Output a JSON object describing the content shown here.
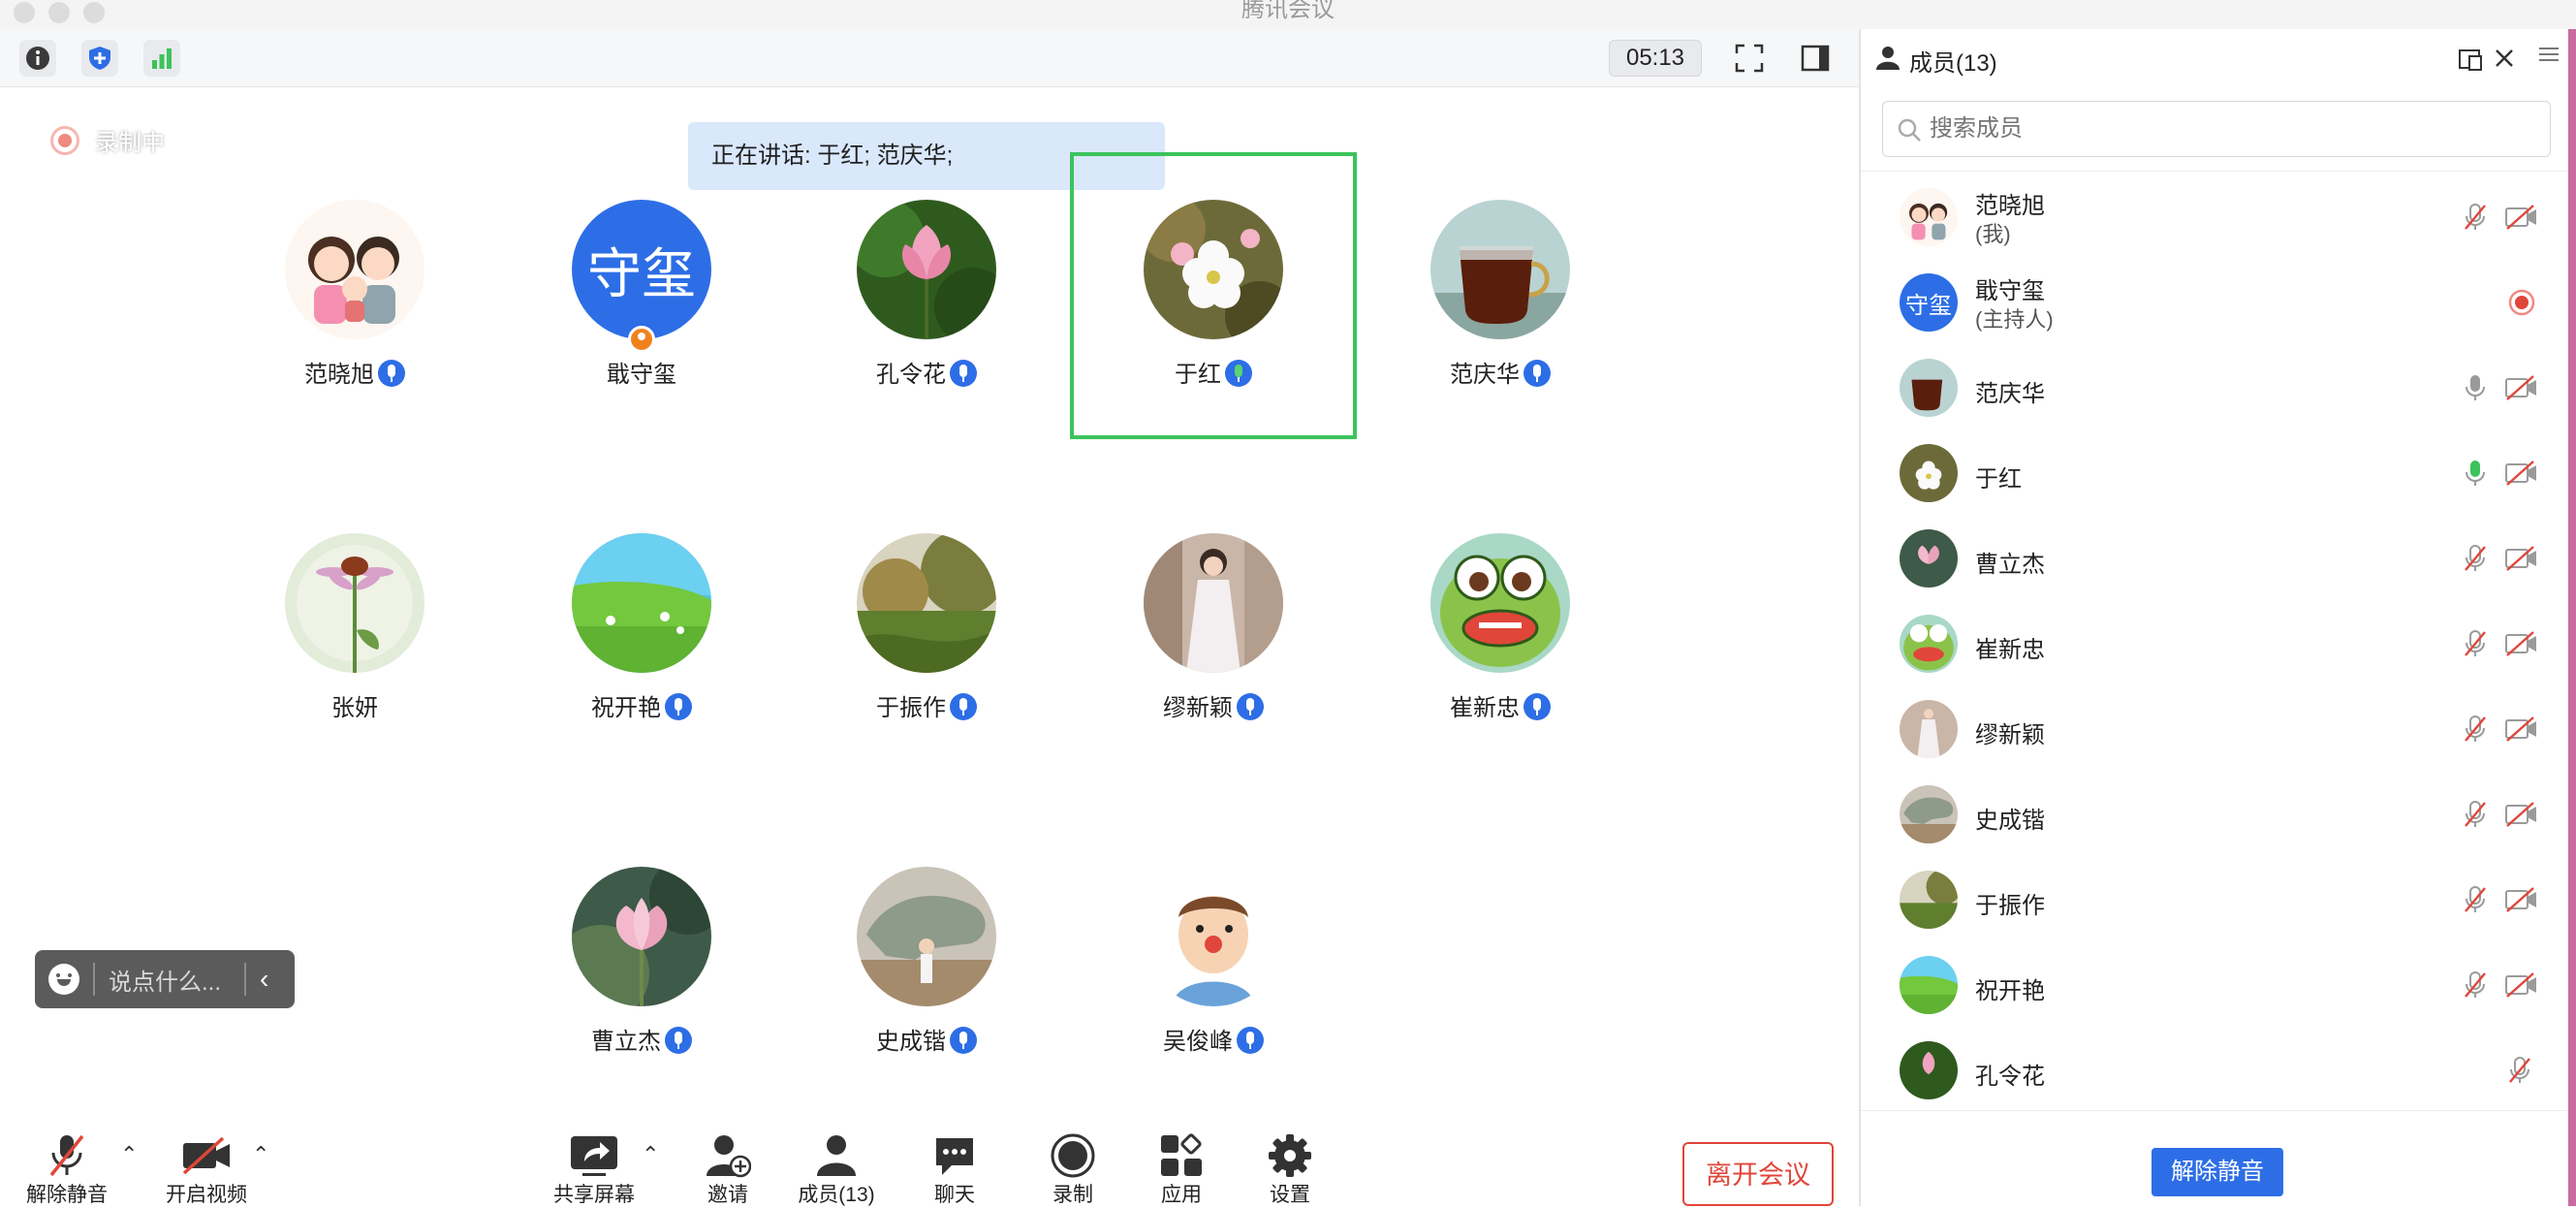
{
  "app": {
    "title": "腾讯会议"
  },
  "topbar": {
    "timer": "05:13"
  },
  "recording": {
    "label": "录制中"
  },
  "speaking": {
    "text": "正在讲话: 于红; 范庆华;"
  },
  "participants": [
    {
      "name": "范晓旭",
      "avatar": "cartoon-family-avatar",
      "mic_badge": true
    },
    {
      "name": "戢守玺",
      "avatar": "text-avatar",
      "avatar_text": "守玺",
      "host_badge": true,
      "mic_badge": false
    },
    {
      "name": "孔令花",
      "avatar": "pink-lotus-avatar",
      "mic_badge": true
    },
    {
      "name": "于红",
      "avatar": "white-flower-avatar",
      "mic_badge": true,
      "speaking": true
    },
    {
      "name": "范庆华",
      "avatar": "tea-cup-avatar",
      "mic_badge": true
    },
    {
      "name": "张妍",
      "avatar": "coneflower-avatar",
      "mic_badge": false
    },
    {
      "name": "祝开艳",
      "avatar": "green-meadow-avatar",
      "mic_badge": true
    },
    {
      "name": "于振作",
      "avatar": "autumn-grass-avatar",
      "mic_badge": true
    },
    {
      "name": "缪新颖",
      "avatar": "girl-white-dress-avatar",
      "mic_badge": true
    },
    {
      "name": "崔新忠",
      "avatar": "cartoon-frog-avatar",
      "mic_badge": true
    },
    {
      "name": "曹立杰",
      "avatar": "lotus-bud-avatar",
      "mic_badge": true
    },
    {
      "name": "史成锴",
      "avatar": "dinosaur-statue-avatar",
      "mic_badge": true
    },
    {
      "name": "吴俊峰",
      "avatar": "cartoon-boy-avatar",
      "mic_badge": true
    }
  ],
  "chat_input": {
    "placeholder": "说点什么..."
  },
  "toolbar": {
    "unmute": "解除静音",
    "start_video": "开启视频",
    "share_screen": "共享屏幕",
    "invite": "邀请",
    "members": "成员(13)",
    "chat": "聊天",
    "record": "录制",
    "apps": "应用",
    "settings": "设置",
    "leave": "离开会议"
  },
  "panel": {
    "title": "成员(13)",
    "search_placeholder": "搜索成员",
    "unmute_all": "解除静音",
    "members": [
      {
        "name": "范晓旭",
        "sub": "(我)",
        "mic": "muted",
        "cam": "off"
      },
      {
        "name": "戢守玺",
        "sub": "(主持人)",
        "status": "recording",
        "avatar_text": "守玺"
      },
      {
        "name": "范庆华",
        "mic": "on",
        "cam": "off"
      },
      {
        "name": "于红",
        "mic": "speaking",
        "cam": "off"
      },
      {
        "name": "曹立杰",
        "mic": "muted",
        "cam": "off"
      },
      {
        "name": "崔新忠",
        "mic": "muted",
        "cam": "off"
      },
      {
        "name": "缪新颖",
        "mic": "muted",
        "cam": "off"
      },
      {
        "name": "史成锴",
        "mic": "muted",
        "cam": "off"
      },
      {
        "name": "于振作",
        "mic": "muted",
        "cam": "off"
      },
      {
        "name": "祝开艳",
        "mic": "muted",
        "cam": "off"
      },
      {
        "name": "孔令花",
        "mic": "muted"
      }
    ]
  },
  "colors": {
    "accent": "#2d6ee6",
    "speaking_frame": "#3cc35c",
    "leave": "#e0463a",
    "recording": "#f0463a"
  }
}
